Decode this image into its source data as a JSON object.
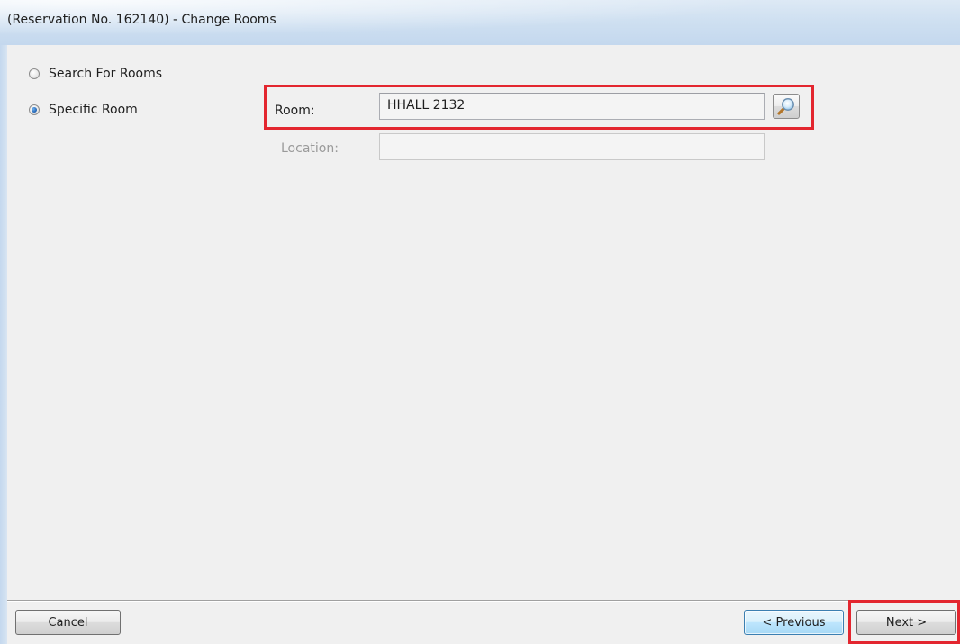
{
  "window": {
    "title": "(Reservation No. 162140) - Change Rooms"
  },
  "options": {
    "search_for_rooms": {
      "label": "Search For Rooms",
      "checked": false
    },
    "specific_room": {
      "label": "Specific Room",
      "checked": true
    }
  },
  "fields": {
    "room": {
      "label": "Room:",
      "value": "HHALL 2132"
    },
    "location": {
      "label": "Location:",
      "value": "",
      "disabled": true
    }
  },
  "icons": {
    "lookup": "magnifier-icon"
  },
  "buttons": {
    "cancel": "Cancel",
    "previous": "< Previous",
    "next": "Next >"
  },
  "colors": {
    "highlight": "#e3262f",
    "default_button_border": "#3c7fb1"
  }
}
